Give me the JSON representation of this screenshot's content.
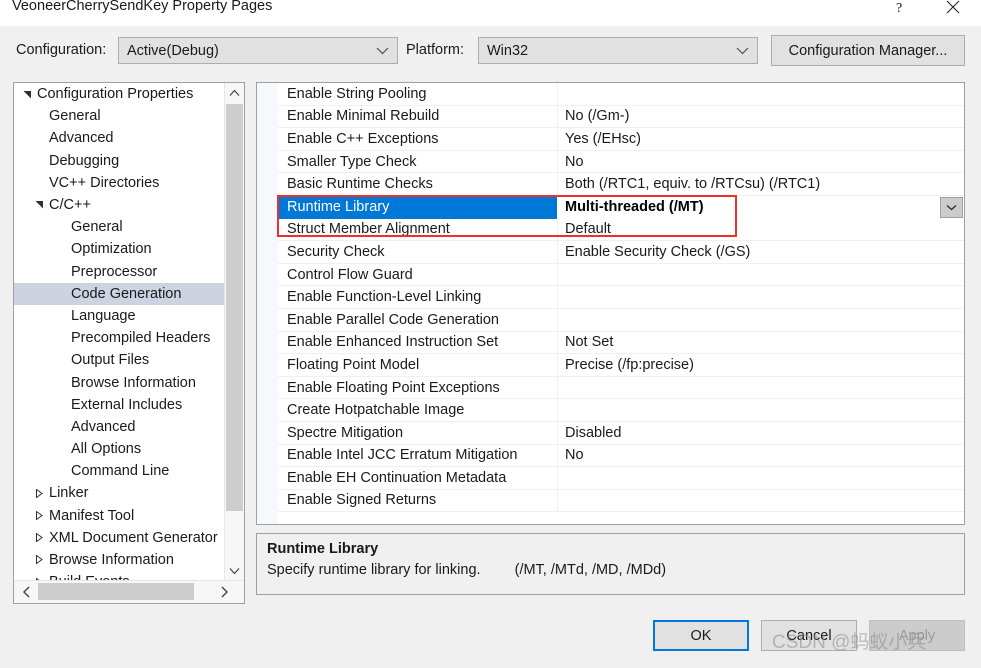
{
  "window": {
    "title": "VeoneerCherrySendKey Property Pages",
    "help_icon": "question-mark-icon",
    "close_icon": "close-icon"
  },
  "configbar": {
    "configuration_label": "Configuration:",
    "configuration_value": "Active(Debug)",
    "platform_label": "Platform:",
    "platform_value": "Win32",
    "configuration_manager_label": "Configuration Manager..."
  },
  "tree": {
    "selected": "Code Generation",
    "items": [
      {
        "label": "Configuration Properties",
        "indent": 0,
        "twisty": "expanded"
      },
      {
        "label": "General",
        "indent": 1,
        "twisty": "none"
      },
      {
        "label": "Advanced",
        "indent": 1,
        "twisty": "none"
      },
      {
        "label": "Debugging",
        "indent": 1,
        "twisty": "none"
      },
      {
        "label": "VC++ Directories",
        "indent": 1,
        "twisty": "none"
      },
      {
        "label": "C/C++",
        "indent": 1,
        "twisty": "expanded"
      },
      {
        "label": "General",
        "indent": 2,
        "twisty": "none"
      },
      {
        "label": "Optimization",
        "indent": 2,
        "twisty": "none"
      },
      {
        "label": "Preprocessor",
        "indent": 2,
        "twisty": "none"
      },
      {
        "label": "Code Generation",
        "indent": 2,
        "twisty": "none",
        "selected": true
      },
      {
        "label": "Language",
        "indent": 2,
        "twisty": "none"
      },
      {
        "label": "Precompiled Headers",
        "indent": 2,
        "twisty": "none"
      },
      {
        "label": "Output Files",
        "indent": 2,
        "twisty": "none"
      },
      {
        "label": "Browse Information",
        "indent": 2,
        "twisty": "none"
      },
      {
        "label": "External Includes",
        "indent": 2,
        "twisty": "none"
      },
      {
        "label": "Advanced",
        "indent": 2,
        "twisty": "none"
      },
      {
        "label": "All Options",
        "indent": 2,
        "twisty": "none"
      },
      {
        "label": "Command Line",
        "indent": 2,
        "twisty": "none"
      },
      {
        "label": "Linker",
        "indent": 1,
        "twisty": "collapsed"
      },
      {
        "label": "Manifest Tool",
        "indent": 1,
        "twisty": "collapsed"
      },
      {
        "label": "XML Document Generator",
        "indent": 1,
        "twisty": "collapsed"
      },
      {
        "label": "Browse Information",
        "indent": 1,
        "twisty": "collapsed"
      },
      {
        "label": "Build Events",
        "indent": 1,
        "twisty": "collapsed"
      }
    ]
  },
  "grid": {
    "selected_row": "Runtime Library",
    "dropdown_icon": "chevron-down-icon",
    "rows": [
      {
        "name": "Enable String Pooling",
        "value": ""
      },
      {
        "name": "Enable Minimal Rebuild",
        "value": "No (/Gm-)"
      },
      {
        "name": "Enable C++ Exceptions",
        "value": "Yes (/EHsc)"
      },
      {
        "name": "Smaller Type Check",
        "value": "No"
      },
      {
        "name": "Basic Runtime Checks",
        "value": "Both (/RTC1, equiv. to /RTCsu) (/RTC1)"
      },
      {
        "name": "Runtime Library",
        "value": "Multi-threaded (/MT)",
        "selected": true
      },
      {
        "name": "Struct Member Alignment",
        "value": "Default"
      },
      {
        "name": "Security Check",
        "value": "Enable Security Check (/GS)"
      },
      {
        "name": "Control Flow Guard",
        "value": ""
      },
      {
        "name": "Enable Function-Level Linking",
        "value": ""
      },
      {
        "name": "Enable Parallel Code Generation",
        "value": ""
      },
      {
        "name": "Enable Enhanced Instruction Set",
        "value": "Not Set"
      },
      {
        "name": "Floating Point Model",
        "value": "Precise (/fp:precise)"
      },
      {
        "name": "Enable Floating Point Exceptions",
        "value": ""
      },
      {
        "name": "Create Hotpatchable Image",
        "value": ""
      },
      {
        "name": "Spectre Mitigation",
        "value": "Disabled"
      },
      {
        "name": "Enable Intel JCC Erratum Mitigation",
        "value": "No"
      },
      {
        "name": "Enable EH Continuation Metadata",
        "value": ""
      },
      {
        "name": "Enable Signed Returns",
        "value": ""
      }
    ]
  },
  "description": {
    "title": "Runtime Library",
    "text": "Specify runtime library for linking.",
    "switches": "(/MT, /MTd, /MD, /MDd)"
  },
  "footer": {
    "ok_label": "OK",
    "cancel_label": "Cancel",
    "apply_label": "Apply"
  },
  "watermark": {
    "text": "CSDN @蚂蚁小兵"
  },
  "colors": {
    "selection_blue": "#0078d7",
    "tree_selection": "#cdd3e0",
    "annotation_red": "#e8322a",
    "dialog_bg": "#f0f0f0"
  }
}
